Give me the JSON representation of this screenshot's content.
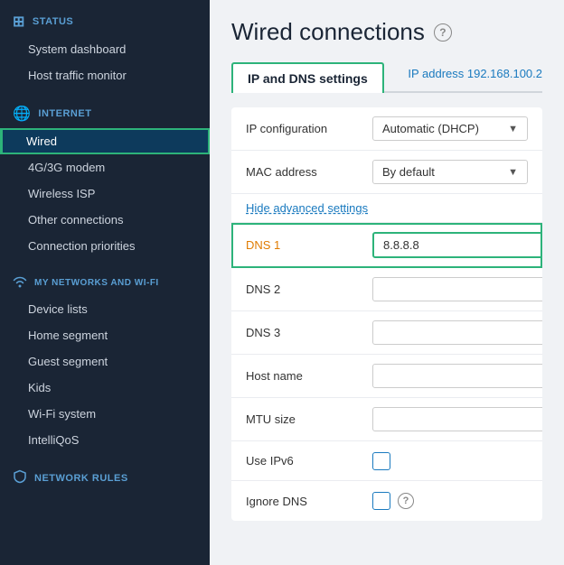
{
  "sidebar": {
    "sections": [
      {
        "id": "status",
        "label": "STATUS",
        "icon": "⊞",
        "items": [
          {
            "id": "system-dashboard",
            "label": "System dashboard",
            "active": false
          },
          {
            "id": "host-traffic-monitor",
            "label": "Host traffic monitor",
            "active": false
          }
        ]
      },
      {
        "id": "internet",
        "label": "INTERNET",
        "icon": "🌐",
        "items": [
          {
            "id": "wired",
            "label": "Wired",
            "active": true
          },
          {
            "id": "4g3g-modem",
            "label": "4G/3G modem",
            "active": false
          },
          {
            "id": "wireless-isp",
            "label": "Wireless ISP",
            "active": false
          },
          {
            "id": "other-connections",
            "label": "Other connections",
            "active": false
          },
          {
            "id": "connection-priorities",
            "label": "Connection priorities",
            "active": false
          }
        ]
      },
      {
        "id": "my-networks",
        "label": "MY NETWORKS AND WI-FI",
        "icon": "📶",
        "items": [
          {
            "id": "device-lists",
            "label": "Device lists",
            "active": false
          },
          {
            "id": "home-segment",
            "label": "Home segment",
            "active": false
          },
          {
            "id": "guest-segment",
            "label": "Guest segment",
            "active": false
          },
          {
            "id": "kids",
            "label": "Kids",
            "active": false
          },
          {
            "id": "wifi-system",
            "label": "Wi-Fi system",
            "active": false
          },
          {
            "id": "intelliqos",
            "label": "IntelliQoS",
            "active": false
          }
        ]
      },
      {
        "id": "network-rules",
        "label": "NETWORK RULES",
        "icon": "🛡",
        "items": []
      }
    ]
  },
  "main": {
    "title": "Wired connections",
    "tab": "IP and DNS settings",
    "ip_address": "IP address 192.168.100.2",
    "help": "?",
    "fields": [
      {
        "id": "ip-configuration",
        "label": "IP configuration",
        "type": "select",
        "value": "Automatic (DHCP)",
        "orange": false
      },
      {
        "id": "mac-address",
        "label": "MAC address",
        "type": "select",
        "value": "By default",
        "orange": false
      },
      {
        "id": "advanced-link",
        "label": "Hide advanced settings",
        "type": "link"
      },
      {
        "id": "dns1",
        "label": "DNS 1",
        "type": "input",
        "value": "8.8.8.8",
        "highlighted": true,
        "orange": true
      },
      {
        "id": "dns2",
        "label": "DNS 2",
        "type": "input",
        "value": "",
        "highlighted": false,
        "orange": false
      },
      {
        "id": "dns3",
        "label": "DNS 3",
        "type": "input",
        "value": "",
        "highlighted": false,
        "orange": false
      },
      {
        "id": "hostname",
        "label": "Host name",
        "type": "input",
        "value": "",
        "highlighted": false,
        "orange": false
      },
      {
        "id": "mtu-size",
        "label": "MTU size",
        "type": "input",
        "value": "",
        "highlighted": false,
        "orange": false
      },
      {
        "id": "use-ipv6",
        "label": "Use IPv6",
        "type": "checkbox",
        "orange": false
      },
      {
        "id": "ignore-dns",
        "label": "Ignore DNS",
        "type": "checkbox-help",
        "orange": false
      }
    ]
  }
}
